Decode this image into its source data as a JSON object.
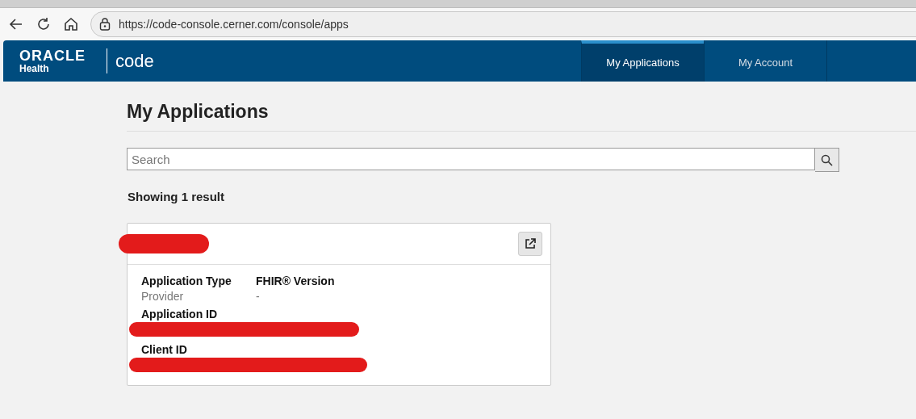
{
  "browser": {
    "url": "https://code-console.cerner.com/console/apps"
  },
  "header": {
    "logo_top": "ORACLE",
    "logo_bottom": "Health",
    "product": "code",
    "tabs": [
      {
        "label": "My Applications",
        "selected": true
      },
      {
        "label": "My Account",
        "selected": false
      }
    ]
  },
  "page": {
    "title": "My Applications",
    "search": {
      "placeholder": "Search"
    },
    "result_count": "Showing 1 result"
  },
  "card": {
    "title_redacted": true,
    "fields": [
      {
        "label": "Application Type",
        "value": "Provider"
      },
      {
        "label": "FHIR® Version",
        "value": "-"
      },
      {
        "label": "Application ID",
        "redacted": true
      },
      {
        "label": "Client ID",
        "redacted": true
      }
    ]
  }
}
